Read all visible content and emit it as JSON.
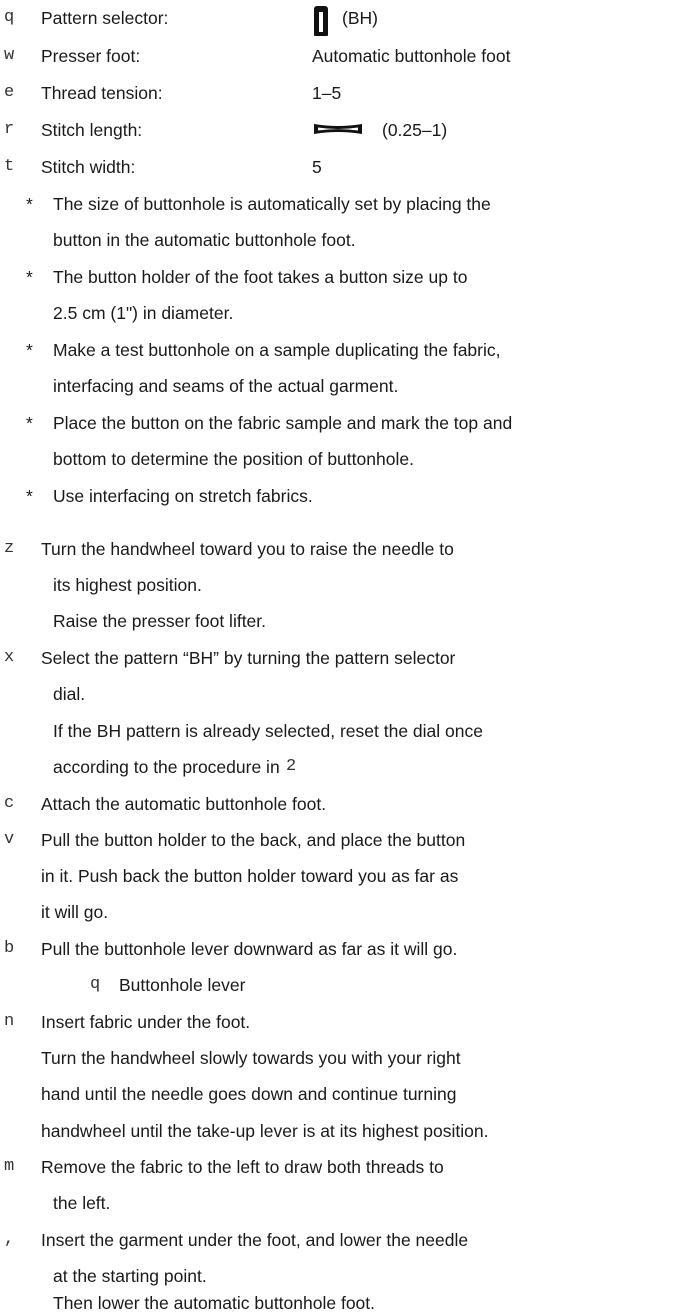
{
  "settings": [
    {
      "marker": "q",
      "label": "Pattern selector:",
      "value": "(BH)"
    },
    {
      "marker": "w",
      "label": "Presser foot:",
      "value": "Automatic buttonhole foot"
    },
    {
      "marker": "e",
      "label": "Thread tension:",
      "value": "1–5"
    },
    {
      "marker": "r",
      "label": "Stitch length:",
      "value": "(0.25–1)"
    },
    {
      "marker": "t",
      "label": "Stitch width:",
      "value": "5"
    }
  ],
  "notes": [
    {
      "marker": "*",
      "lines": [
        "The size of buttonhole is automatically set by placing the",
        "button in the automatic buttonhole foot."
      ]
    },
    {
      "marker": "*",
      "lines": [
        "The button holder of the foot takes a button size up to",
        "2.5 cm (1\") in diameter."
      ]
    },
    {
      "marker": "*",
      "lines": [
        "Make a test buttonhole on a sample duplicating the fabric,",
        "interfacing and seams of the actual garment."
      ]
    },
    {
      "marker": "*",
      "lines": [
        "Place the button on the fabric sample and mark the top and",
        "bottom to determine the position of buttonhole."
      ]
    },
    {
      "marker": "*",
      "lines": [
        "Use interfacing on stretch fabrics."
      ]
    }
  ],
  "steps": [
    {
      "marker": "z",
      "lines": [
        "Turn the handwheel toward you to raise the needle to",
        "its highest position.",
        "Raise the presser foot lifter."
      ]
    },
    {
      "marker": "x",
      "lines": [
        "Select the pattern “BH” by turning the pattern selector",
        "dial.",
        "If the BH pattern is already selected, reset the dial once",
        "according to the procedure in"
      ],
      "ref": "2"
    },
    {
      "marker": "c",
      "lines": [
        "Attach the automatic buttonhole foot."
      ]
    },
    {
      "marker": "v",
      "lines": [
        "Pull the button holder to the back, and place the button",
        "in it. Push back the button holder toward you as far as",
        "it will go."
      ]
    },
    {
      "marker": "b",
      "lines": [
        "Pull the buttonhole lever downward as far as it will go."
      ],
      "sub": {
        "marker": "q",
        "label": "Buttonhole lever"
      }
    },
    {
      "marker": "n",
      "lines": [
        "Insert fabric under the foot.",
        "Turn the handwheel slowly towards you with your right",
        "hand until the needle goes down and continue turning",
        "handwheel until the take-up lever is at its highest position."
      ]
    },
    {
      "marker": "m",
      "lines": [
        "Remove the fabric to the left to draw both threads to",
        "the left."
      ]
    },
    {
      "marker": ",",
      "lines": [
        "Insert the garment under the foot, and lower the needle",
        "at the starting point.",
        "Then lower the automatic buttonhole foot."
      ]
    }
  ]
}
